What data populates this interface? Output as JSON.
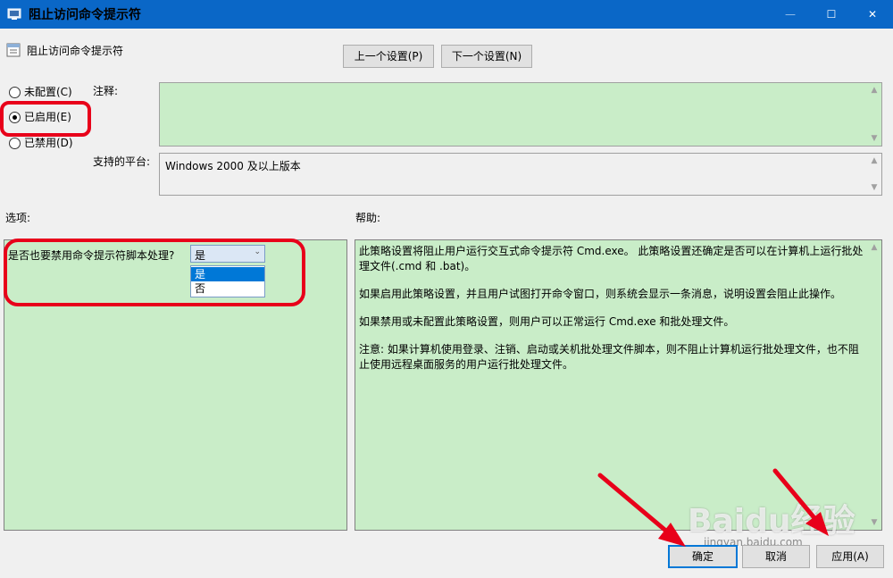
{
  "window": {
    "title": "阻止访问命令提示符",
    "minimize_glyph": "—",
    "maximize_glyph": "☐",
    "close_glyph": "✕"
  },
  "policy": {
    "name": "阻止访问命令提示符"
  },
  "nav": {
    "prev_label": "上一个设置(P)",
    "next_label": "下一个设置(N)"
  },
  "radios": {
    "unconfigured": "未配置(C)",
    "enabled": "已启用(E)",
    "disabled": "已禁用(D)",
    "selected": "enabled"
  },
  "labels": {
    "comment": "注释:",
    "platform": "支持的平台:",
    "options": "选项:",
    "help": "帮助:"
  },
  "comment_value": "",
  "platform_value": "Windows 2000 及以上版本",
  "options": {
    "question": "是否也要禁用命令提示符脚本处理?",
    "selected": "是",
    "dropdown_options": [
      "是",
      "否"
    ]
  },
  "help_paragraphs": [
    "此策略设置将阻止用户运行交互式命令提示符 Cmd.exe。 此策略设置还确定是否可以在计算机上运行批处理文件(.cmd 和 .bat)。",
    "如果启用此策略设置，并且用户试图打开命令窗口，则系统会显示一条消息，说明设置会阻止此操作。",
    "如果禁用或未配置此策略设置，则用户可以正常运行 Cmd.exe 和批处理文件。",
    "注意: 如果计算机使用登录、注销、启动或关机批处理文件脚本，则不阻止计算机运行批处理文件，也不阻止使用远程桌面服务的用户运行批处理文件。"
  ],
  "buttons": {
    "ok": "确定",
    "cancel": "取消",
    "apply": "应用(A)"
  },
  "watermark": {
    "brand": "Baidu经验",
    "site": "jingyan.baidu.com"
  },
  "colors": {
    "titlebar": "#0a67c7",
    "panel_green": "#c9edc8",
    "highlight_red": "#e8001a",
    "accent_blue": "#0078d7"
  }
}
